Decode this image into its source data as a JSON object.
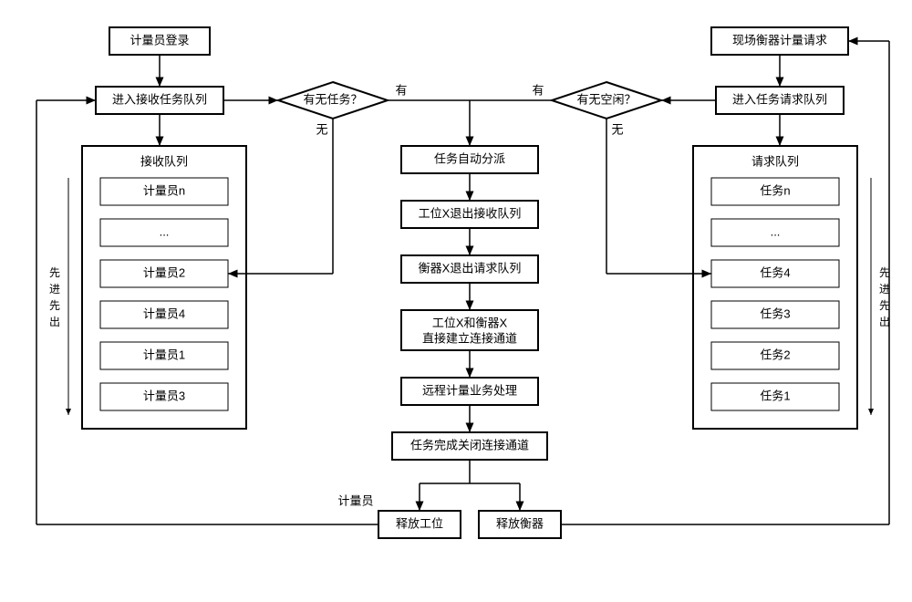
{
  "left": {
    "start": "计量员登录",
    "enter": "进入接收任务队列",
    "queueTitle": "接收队列",
    "queueItems": [
      "计量员n",
      "...",
      "计量员2",
      "计量员4",
      "计量员1",
      "计量员3"
    ],
    "fifo": "先进先出"
  },
  "right": {
    "start": "现场衡器计量请求",
    "enter": "进入任务请求队列",
    "queueTitle": "请求队列",
    "queueItems": [
      "任务n",
      "...",
      "任务4",
      "任务3",
      "任务2",
      "任务1"
    ],
    "fifo": "先进先出"
  },
  "center": {
    "decisionLeft": "有无任务？",
    "decisionRight": "有无空闲？",
    "yes": "有",
    "no": "无",
    "steps": [
      "任务自动分派",
      "工位X退出接收队列",
      "衡器X退出请求队列",
      "工位X和衡器X\n直接建立连接通道",
      "远程计量业务处理",
      "任务完成关闭连接通道"
    ],
    "releaseStation": "释放工位",
    "releaseScale": "释放衡器",
    "operator": "计量员"
  }
}
